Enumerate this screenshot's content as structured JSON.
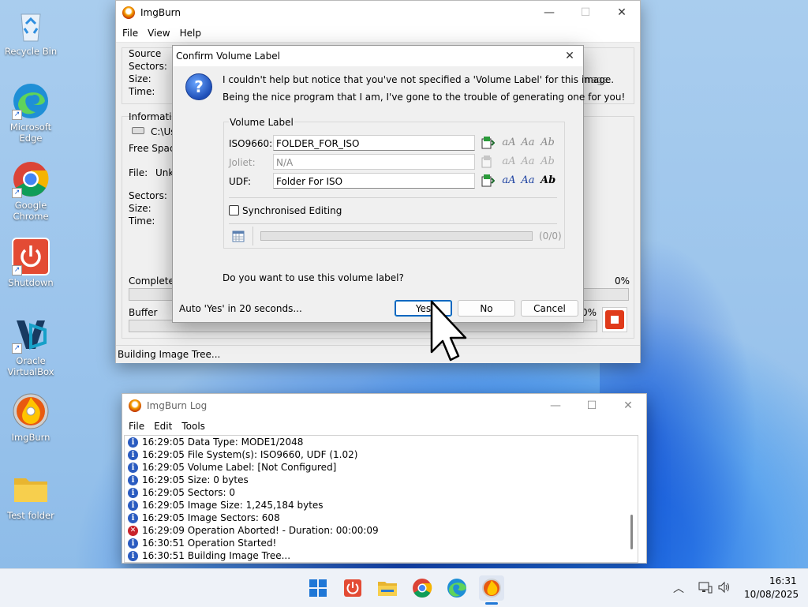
{
  "desktop": {
    "icons": [
      {
        "label": "Recycle Bin"
      },
      {
        "label": "Microsoft Edge"
      },
      {
        "label": "Google Chrome"
      },
      {
        "label": "Shutdown"
      },
      {
        "label": "Oracle VirtualBox"
      },
      {
        "label": "ImgBurn"
      },
      {
        "label": "Test folder"
      }
    ]
  },
  "imgburn": {
    "title": "ImgBurn",
    "menu": [
      "File",
      "View",
      "Help"
    ],
    "source": {
      "label": "Source",
      "sectors": "Sectors:",
      "size": "Size:",
      "time": "Time:",
      "right_fragment": "mage"
    },
    "information": {
      "label": "Informatio",
      "drive": "C:\\Us",
      "free_space": "Free Space"
    },
    "file": {
      "label": "File:",
      "value": "Unk"
    },
    "dest": {
      "sectors": "Sectors:",
      "size": "Size:",
      "time": "Time:"
    },
    "complete": {
      "label": "Complete",
      "percent": "0%"
    },
    "buffer": {
      "label": "Buffer",
      "percent": "0%"
    },
    "status": "Building Image Tree..."
  },
  "dialog": {
    "title": "Confirm Volume Label",
    "message_line1": "I couldn't help but notice that you've not specified a 'Volume Label' for this image.",
    "message_line2": "Being the nice program that I am, I've gone to the trouble of generating one for you!",
    "group_label": "Volume Label",
    "iso_label": "ISO9660:",
    "iso_value": "FOLDER_FOR_ISO",
    "joliet_label": "Joliet:",
    "joliet_value": "N/A",
    "udf_label": "UDF:",
    "udf_value": "Folder For ISO",
    "sync_label": "Synchronised Editing",
    "progress_count": "(0/0)",
    "question": "Do you want to use this volume label?",
    "auto_text": "Auto 'Yes' in 20 seconds...",
    "yes_label": "Yes",
    "no_label": "No",
    "cancel_label": "Cancel"
  },
  "log": {
    "title": "ImgBurn Log",
    "menu": [
      "File",
      "Edit",
      "Tools"
    ],
    "rows": [
      {
        "type": "info",
        "text": "16:29:05 Data Type: MODE1/2048"
      },
      {
        "type": "info",
        "text": "16:29:05 File System(s): ISO9660, UDF (1.02)"
      },
      {
        "type": "info",
        "text": "16:29:05 Volume Label: [Not Configured]"
      },
      {
        "type": "info",
        "text": "16:29:05 Size: 0 bytes"
      },
      {
        "type": "info",
        "text": "16:29:05 Sectors: 0"
      },
      {
        "type": "info",
        "text": "16:29:05 Image Size: 1,245,184 bytes"
      },
      {
        "type": "info",
        "text": "16:29:05 Image Sectors: 608"
      },
      {
        "type": "error",
        "text": "16:29:09 Operation Aborted! - Duration: 00:00:09"
      },
      {
        "type": "info",
        "text": "16:30:51 Operation Started!"
      },
      {
        "type": "info",
        "text": "16:30:51 Building Image Tree..."
      }
    ]
  },
  "taskbar": {
    "time": "16:31",
    "date": "10/08/2025"
  }
}
